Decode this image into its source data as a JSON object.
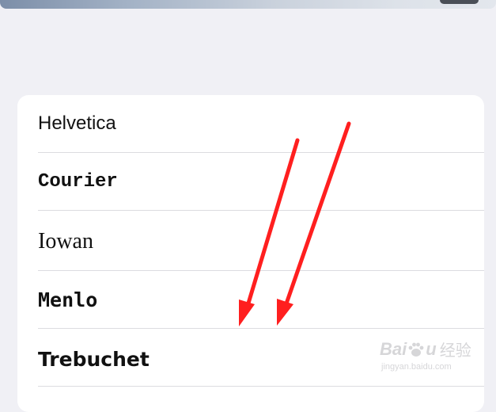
{
  "fonts": [
    {
      "name": "Helvetica"
    },
    {
      "name": "Courier"
    },
    {
      "name": "Iowan"
    },
    {
      "name": "Menlo"
    },
    {
      "name": "Trebuchet"
    }
  ],
  "colors": {
    "background": "#f0f0f5",
    "list_background": "#ffffff",
    "separator": "#dcdce0",
    "annotation_arrow": "#ff1f1f"
  },
  "watermark": {
    "brand_left": "Bai",
    "brand_right": "u",
    "brand_cn": "经验",
    "url": "jingyan.baidu.com"
  }
}
